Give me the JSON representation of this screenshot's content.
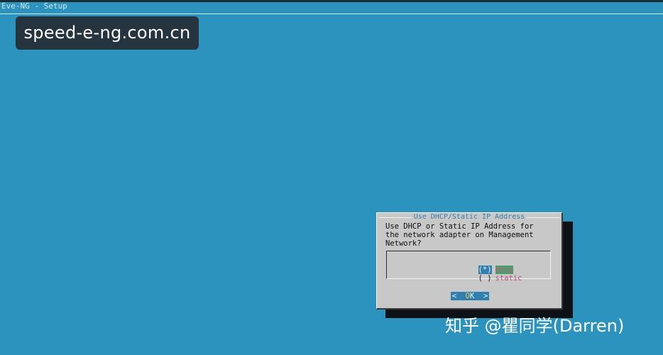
{
  "header": {
    "backtitle": "Eve-NG - Setup"
  },
  "watermark_top": {
    "text": "speed-e-ng.com.cn"
  },
  "dialog": {
    "title": "Use DHCP/Static IP Address",
    "prompt": "Use DHCP or Static IP Address for\nthe network adapter on Management\nNetwork?",
    "options": [
      {
        "mark": "(*)",
        "label": "dhcp",
        "selected": true
      },
      {
        "mark": "( )",
        "label": "static",
        "selected": false
      }
    ],
    "ok_left": "<  ",
    "ok_hot": "O",
    "ok_rest": "K  >"
  },
  "watermark_bottom": {
    "text": "知乎 @瞿同学(Darren)"
  },
  "colors": {
    "background": "#2b93bd",
    "dialog": "#c8c8c8",
    "selection": "#2f7fb0",
    "focus": "#3fa36a"
  }
}
